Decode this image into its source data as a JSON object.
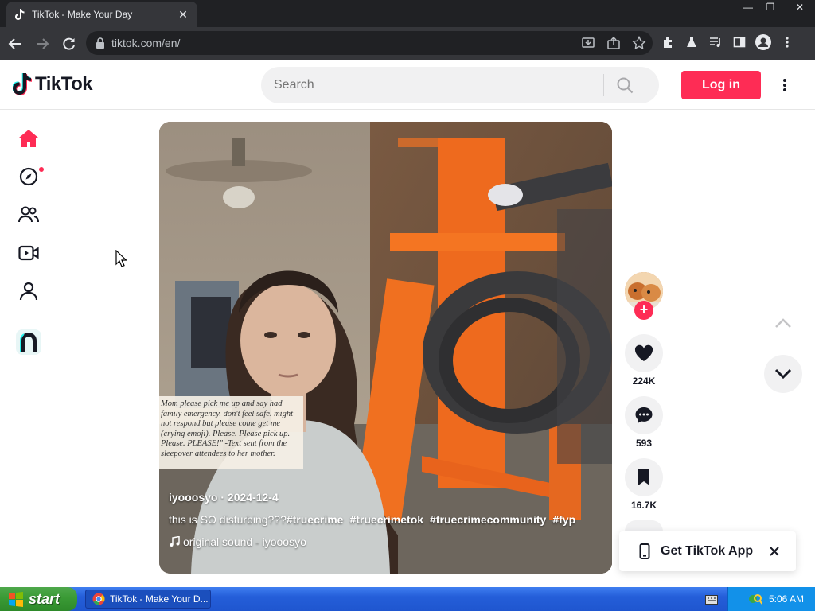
{
  "browser": {
    "tab_title": "TikTok - Make Your Day",
    "tab_close": "✕",
    "url": "tiktok.com/en/",
    "window_controls": {
      "minimize": "—",
      "restore": "❐",
      "close": "✕"
    }
  },
  "header": {
    "logo_text": "TikTok",
    "search_placeholder": "Search",
    "login_label": "Log in"
  },
  "sidebar": {
    "items": [
      "home-icon",
      "explore-icon",
      "following-icon",
      "live-icon",
      "profile-icon",
      "app-icon"
    ],
    "explore_has_notification": true
  },
  "video": {
    "caption_overlay": "Mom please pick me up and say had family emergency. don't feel safe. might not respond but please come get me (crying emoji). Please. Please pick up. Please. PLEASE!\" -Text sent from the sleepover attendees to her mother.",
    "author": "iyooosyo",
    "date": "2024-12-4",
    "description": "this is SO disturbing???",
    "hashtags": [
      "#truecrime",
      "#truecrimetok",
      "#truecrimecommunity",
      "#fyp"
    ],
    "music": "original sound - iyooosyo"
  },
  "actions": {
    "likes": "224K",
    "comments": "593",
    "saves": "16.7K",
    "follow_symbol": "+"
  },
  "get_app": {
    "label": "Get TikTok App"
  },
  "taskbar": {
    "start_label": "start",
    "task_label": "TikTok - Make Your D...",
    "clock": "5:06 AM"
  },
  "colors": {
    "brand_red": "#fe2c55",
    "browser_dark": "#35363a",
    "taskbar_blue": "#245ed9"
  }
}
